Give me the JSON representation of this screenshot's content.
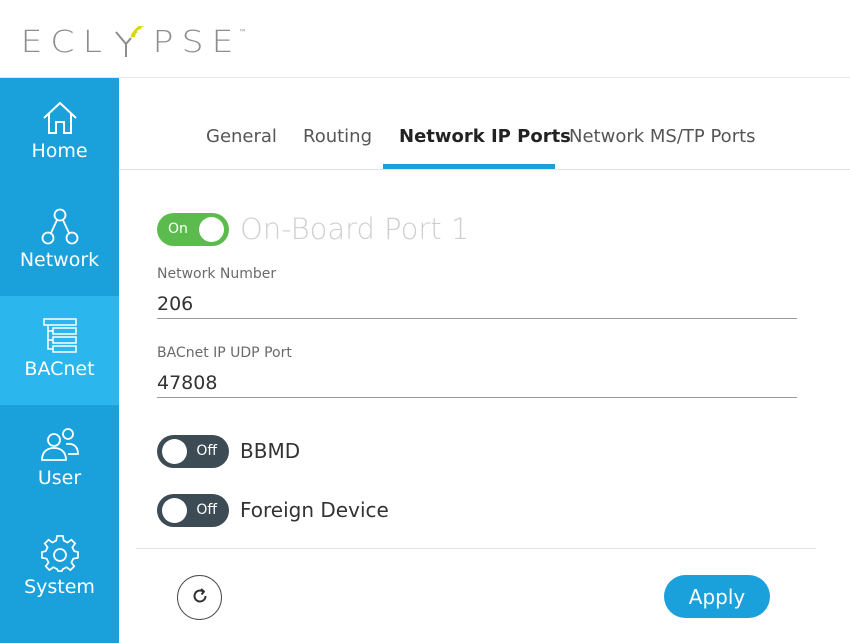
{
  "brand": {
    "letters_before": [
      "E",
      "C",
      "L"
    ],
    "letters_after": [
      "P",
      "S",
      "E"
    ],
    "trademark": "™",
    "accent_color": "#d8d800"
  },
  "sidebar": {
    "color": "#1aa0db",
    "active_color": "#2bb6ee",
    "items": [
      {
        "label": "Home",
        "icon": "home-icon",
        "active": false
      },
      {
        "label": "Network",
        "icon": "network-icon",
        "active": false
      },
      {
        "label": "BACnet",
        "icon": "bacnet-icon",
        "active": true
      },
      {
        "label": "User",
        "icon": "users-icon",
        "active": false
      },
      {
        "label": "System",
        "icon": "gear-icon",
        "active": false
      }
    ]
  },
  "tabs": {
    "items": [
      {
        "label": "General",
        "active": false
      },
      {
        "label": "Routing",
        "active": false
      },
      {
        "label": "Network IP Ports",
        "active": true
      },
      {
        "label": "Network MS/TP Ports",
        "active": false
      }
    ]
  },
  "port": {
    "enabled": true,
    "toggle_label": "On",
    "title": "On-Board Port 1"
  },
  "fields": {
    "network_number": {
      "label": "Network Number",
      "value": "206"
    },
    "udp_port": {
      "label": "BACnet IP UDP Port",
      "value": "47808"
    }
  },
  "switches": {
    "bbmd": {
      "state_label": "Off",
      "label": "BBMD",
      "enabled": false
    },
    "foreign_device": {
      "state_label": "Off",
      "label": "Foreign Device",
      "enabled": false
    }
  },
  "footer": {
    "refresh_icon": "refresh-icon",
    "apply_label": "Apply"
  }
}
